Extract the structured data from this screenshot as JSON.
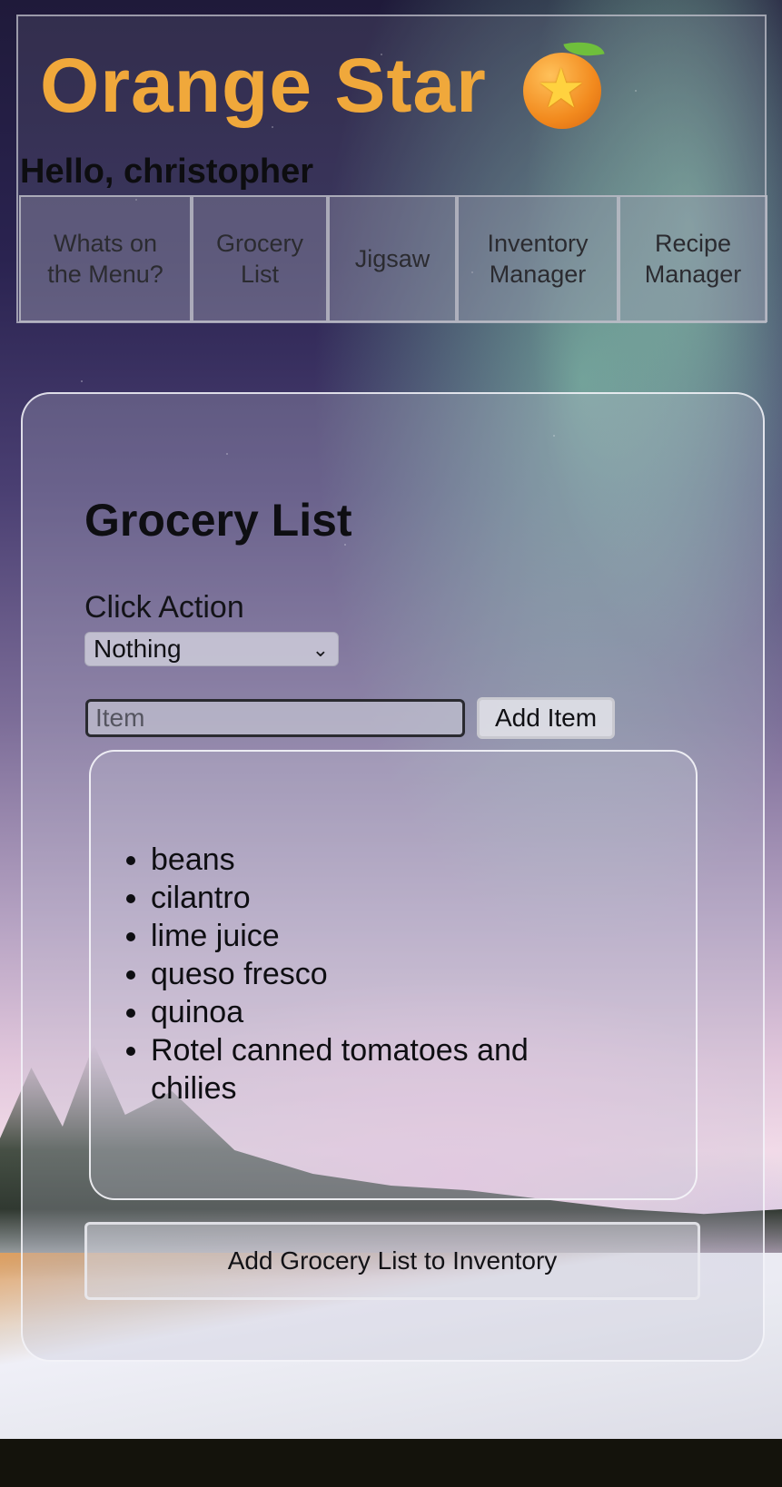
{
  "header": {
    "brand_title": "Orange Star",
    "brand_icon": "orange-star-icon",
    "greeting": "Hello, christopher"
  },
  "nav": {
    "items": [
      {
        "label": "Whats on the Menu?"
      },
      {
        "label": "Grocery List"
      },
      {
        "label": "Jigsaw"
      },
      {
        "label": "Inventory Manager"
      },
      {
        "label": "Recipe Manager"
      }
    ]
  },
  "main": {
    "title": "Grocery List",
    "click_action_label": "Click Action",
    "click_action_value": "Nothing",
    "item_input": {
      "placeholder": "Item",
      "value": ""
    },
    "add_item_label": "Add Item",
    "grocery_items": [
      "beans",
      "cilantro",
      "lime juice",
      "queso fresco",
      "quinoa",
      "Rotel canned tomatoes and chilies"
    ],
    "add_to_inventory_label": "Add Grocery List to Inventory"
  },
  "colors": {
    "brand": "#f0a83b"
  }
}
